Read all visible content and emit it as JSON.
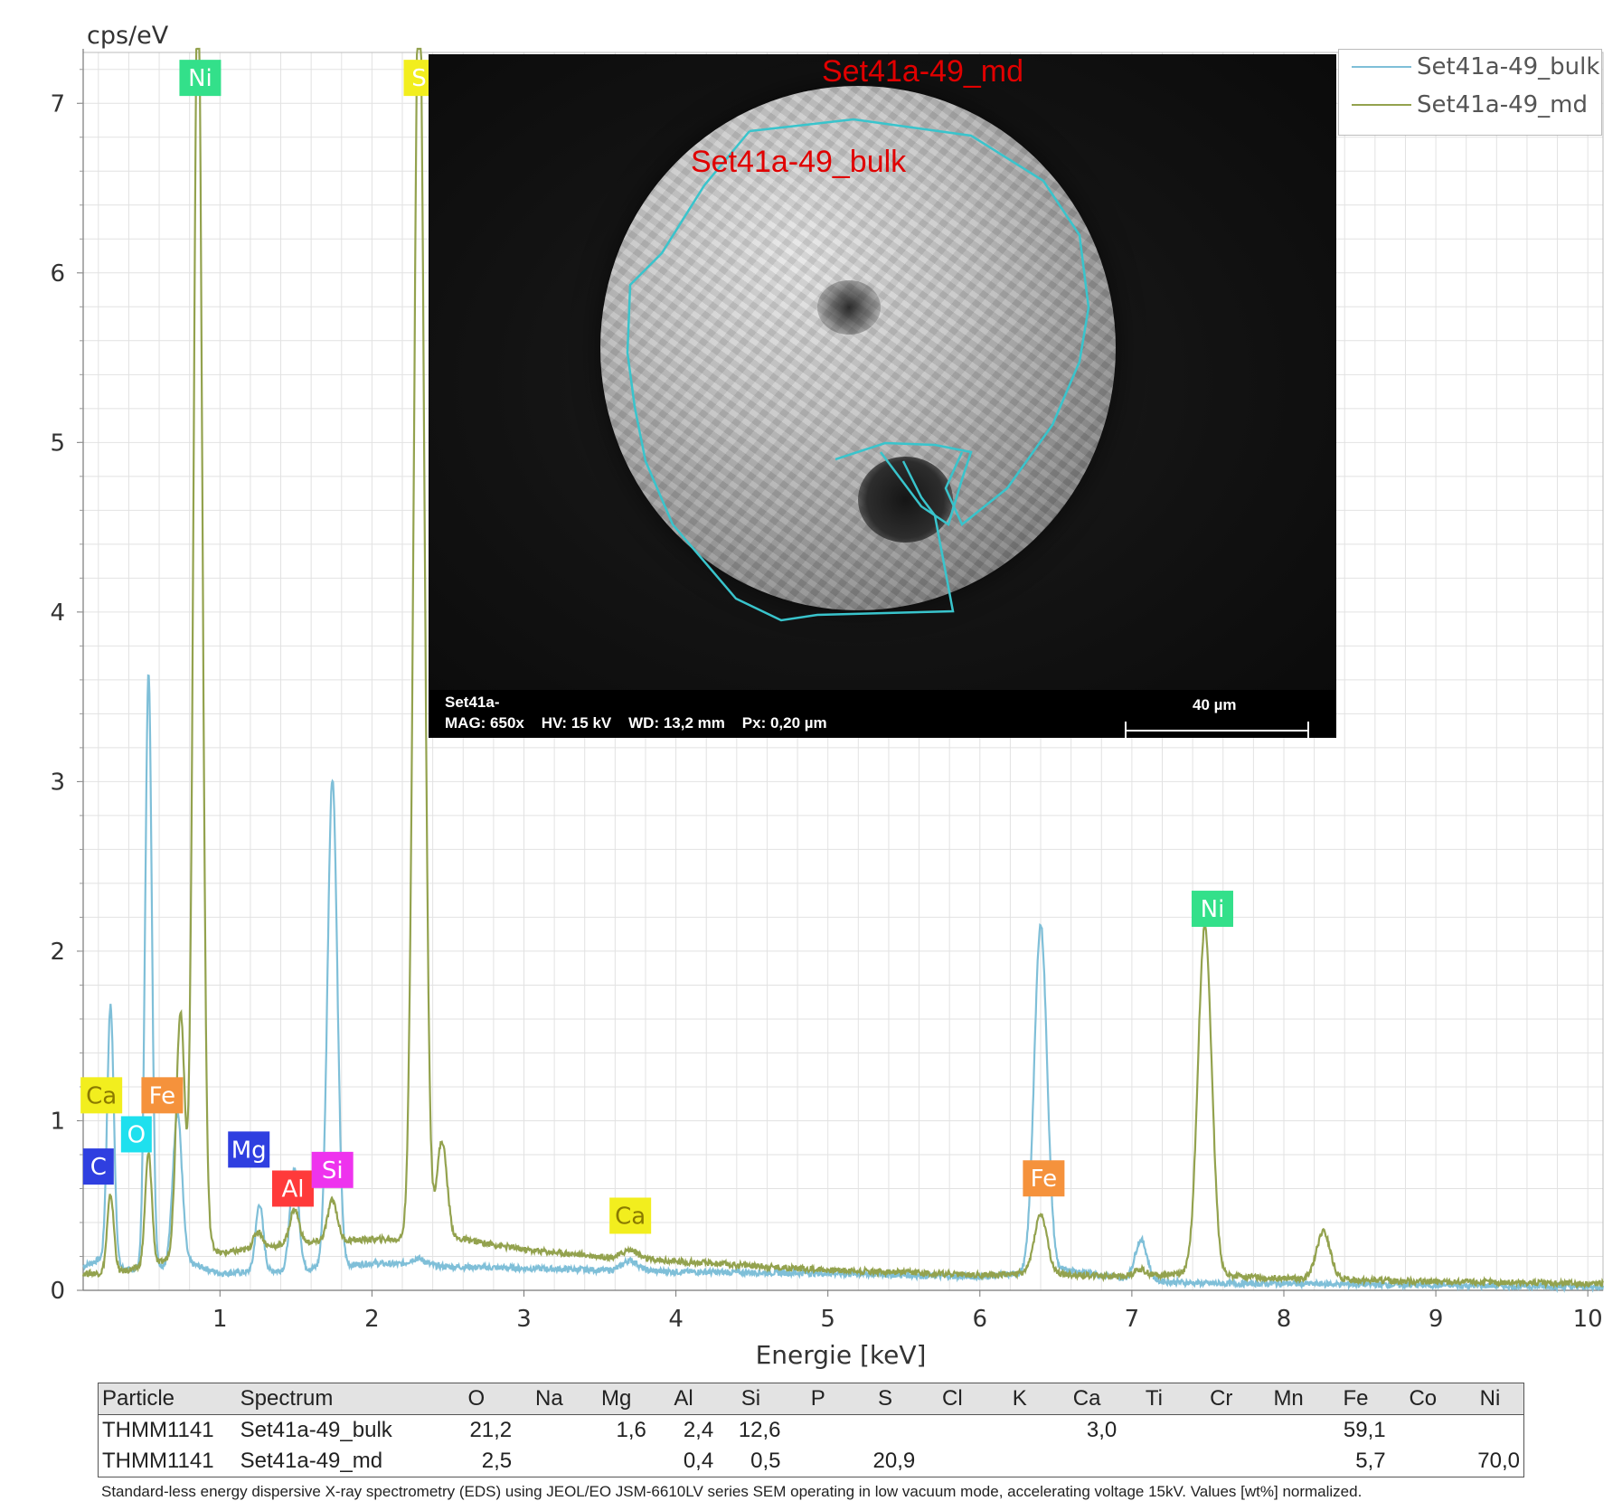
{
  "chart_data": {
    "type": "line",
    "ylabel": "cps/eV",
    "xlabel": "Energie [keV]",
    "xlim": [
      0.1,
      10.1
    ],
    "ylim": [
      0,
      7.3
    ],
    "x_ticks": [
      "1",
      "2",
      "3",
      "4",
      "5",
      "6",
      "7",
      "8",
      "9",
      "10"
    ],
    "y_ticks": [
      "0",
      "1",
      "2",
      "3",
      "4",
      "5",
      "6",
      "7"
    ],
    "grid": true,
    "legend_position": "top-right",
    "series": [
      {
        "name": "Set41a-49_bulk",
        "color": "#7fbfd8",
        "baseline": [
          [
            0.1,
            0.14
          ],
          [
            0.2,
            0.18
          ],
          [
            0.4,
            0.12
          ],
          [
            0.8,
            0.16
          ],
          [
            1.0,
            0.1
          ],
          [
            1.5,
            0.12
          ],
          [
            2.0,
            0.16
          ],
          [
            2.5,
            0.14
          ],
          [
            3.0,
            0.13
          ],
          [
            3.5,
            0.12
          ],
          [
            4.0,
            0.11
          ],
          [
            5.0,
            0.1
          ],
          [
            6.0,
            0.08
          ],
          [
            6.3,
            0.1
          ],
          [
            6.6,
            0.12
          ],
          [
            7.0,
            0.06
          ],
          [
            7.5,
            0.04
          ],
          [
            8.0,
            0.04
          ],
          [
            9.0,
            0.03
          ],
          [
            10.1,
            0.02
          ]
        ],
        "peaks": [
          {
            "x": 0.28,
            "height": 1.52,
            "width": 0.022
          },
          {
            "x": 0.53,
            "height": 3.5,
            "width": 0.022
          },
          {
            "x": 0.72,
            "height": 0.9,
            "width": 0.03
          },
          {
            "x": 1.26,
            "height": 0.4,
            "width": 0.025
          },
          {
            "x": 1.49,
            "height": 0.6,
            "width": 0.028
          },
          {
            "x": 1.74,
            "height": 2.88,
            "width": 0.032
          },
          {
            "x": 2.3,
            "height": 0.04,
            "width": 0.05
          },
          {
            "x": 3.7,
            "height": 0.06,
            "width": 0.05
          },
          {
            "x": 6.4,
            "height": 2.05,
            "width": 0.042
          },
          {
            "x": 7.06,
            "height": 0.24,
            "width": 0.04
          }
        ]
      },
      {
        "name": "Set41a-49_md",
        "color": "#93a24e",
        "baseline": [
          [
            0.1,
            0.1
          ],
          [
            0.3,
            0.1
          ],
          [
            0.6,
            0.16
          ],
          [
            0.9,
            0.3
          ],
          [
            1.0,
            0.22
          ],
          [
            1.2,
            0.24
          ],
          [
            1.5,
            0.28
          ],
          [
            2.0,
            0.3
          ],
          [
            2.2,
            0.3
          ],
          [
            2.6,
            0.3
          ],
          [
            3.0,
            0.24
          ],
          [
            3.5,
            0.2
          ],
          [
            4.0,
            0.17
          ],
          [
            5.0,
            0.12
          ],
          [
            6.0,
            0.09
          ],
          [
            6.3,
            0.1
          ],
          [
            7.0,
            0.08
          ],
          [
            7.3,
            0.1
          ],
          [
            8.0,
            0.07
          ],
          [
            9.0,
            0.05
          ],
          [
            10.1,
            0.04
          ]
        ],
        "peaks": [
          {
            "x": 0.28,
            "height": 0.46,
            "width": 0.022
          },
          {
            "x": 0.53,
            "height": 0.66,
            "width": 0.022
          },
          {
            "x": 0.74,
            "height": 1.42,
            "width": 0.028
          },
          {
            "x": 0.855,
            "height": 7.6,
            "width": 0.028
          },
          {
            "x": 1.25,
            "height": 0.1,
            "width": 0.03
          },
          {
            "x": 1.49,
            "height": 0.2,
            "width": 0.03
          },
          {
            "x": 1.74,
            "height": 0.24,
            "width": 0.032
          },
          {
            "x": 2.31,
            "height": 7.6,
            "width": 0.034
          },
          {
            "x": 2.46,
            "height": 0.58,
            "width": 0.034
          },
          {
            "x": 3.7,
            "height": 0.05,
            "width": 0.05
          },
          {
            "x": 6.4,
            "height": 0.35,
            "width": 0.042
          },
          {
            "x": 7.05,
            "height": 0.04,
            "width": 0.04
          },
          {
            "x": 7.48,
            "height": 2.05,
            "width": 0.045
          },
          {
            "x": 8.26,
            "height": 0.28,
            "width": 0.045
          }
        ]
      }
    ],
    "element_labels": [
      {
        "text": "Ni",
        "x": 0.87,
        "y": 7.15,
        "bg": "#33e08a",
        "fg": "#ffffff"
      },
      {
        "text": "S",
        "x": 2.31,
        "y": 7.15,
        "bg": "#f2ee1e",
        "fg": "#ffffff"
      },
      {
        "text": "Ca",
        "x": 0.22,
        "y": 1.15,
        "bg": "#f2ee1e",
        "fg": "#8a7a00"
      },
      {
        "text": "Fe",
        "x": 0.62,
        "y": 1.15,
        "bg": "#f5923c",
        "fg": "#ffffff"
      },
      {
        "text": "O",
        "x": 0.45,
        "y": 0.92,
        "bg": "#1ee0ee",
        "fg": "#ffffff"
      },
      {
        "text": "C",
        "x": 0.2,
        "y": 0.73,
        "bg": "#2f3fe0",
        "fg": "#ffffff"
      },
      {
        "text": "Mg",
        "x": 1.19,
        "y": 0.83,
        "bg": "#2f3fe0",
        "fg": "#ffffff"
      },
      {
        "text": "Al",
        "x": 1.48,
        "y": 0.6,
        "bg": "#ff3a3a",
        "fg": "#ffffff"
      },
      {
        "text": "Si",
        "x": 1.74,
        "y": 0.71,
        "bg": "#ee33ee",
        "fg": "#ffffff"
      },
      {
        "text": "Ca",
        "x": 3.7,
        "y": 0.44,
        "bg": "#f2ee1e",
        "fg": "#8a7a00"
      },
      {
        "text": "Fe",
        "x": 6.42,
        "y": 0.66,
        "bg": "#f5923c",
        "fg": "#ffffff"
      },
      {
        "text": "Ni",
        "x": 7.53,
        "y": 2.25,
        "bg": "#33e08a",
        "fg": "#ffffff"
      }
    ]
  },
  "sem_image": {
    "label_md": "Set41a-49_md",
    "label_bulk": "Set41a-49_bulk",
    "footer_line1": "Set41a-",
    "footer_line2": "MAG: 650x    HV: 15 kV    WD: 13,2 mm    Px: 0,20 µm",
    "scale_bar_label": "40 µm",
    "roi_color": "#39c4cc"
  },
  "table": {
    "headers": [
      "Particle",
      "Spectrum",
      "O",
      "Na",
      "Mg",
      "Al",
      "Si",
      "P",
      "S",
      "Cl",
      "K",
      "Ca",
      "Ti",
      "Cr",
      "Mn",
      "Fe",
      "Co",
      "Ni"
    ],
    "rows": [
      [
        "THMM1141",
        "Set41a-49_bulk",
        "21,2",
        "",
        "1,6",
        "2,4",
        "12,6",
        "",
        "",
        "",
        "",
        "3,0",
        "",
        "",
        "",
        "59,1",
        "",
        ""
      ],
      [
        "THMM1141",
        "Set41a-49_md",
        "2,5",
        "",
        "",
        "0,4",
        "0,5",
        "",
        "20,9",
        "",
        "",
        "",
        "",
        "",
        "",
        "5,7",
        "",
        "70,0"
      ]
    ]
  },
  "caption": "Standard-less energy dispersive X-ray spectrometry (EDS) using JEOL/EO JSM-6610LV series SEM operating in low vacuum mode, accelerating voltage 15kV. Values [wt%] normalized."
}
